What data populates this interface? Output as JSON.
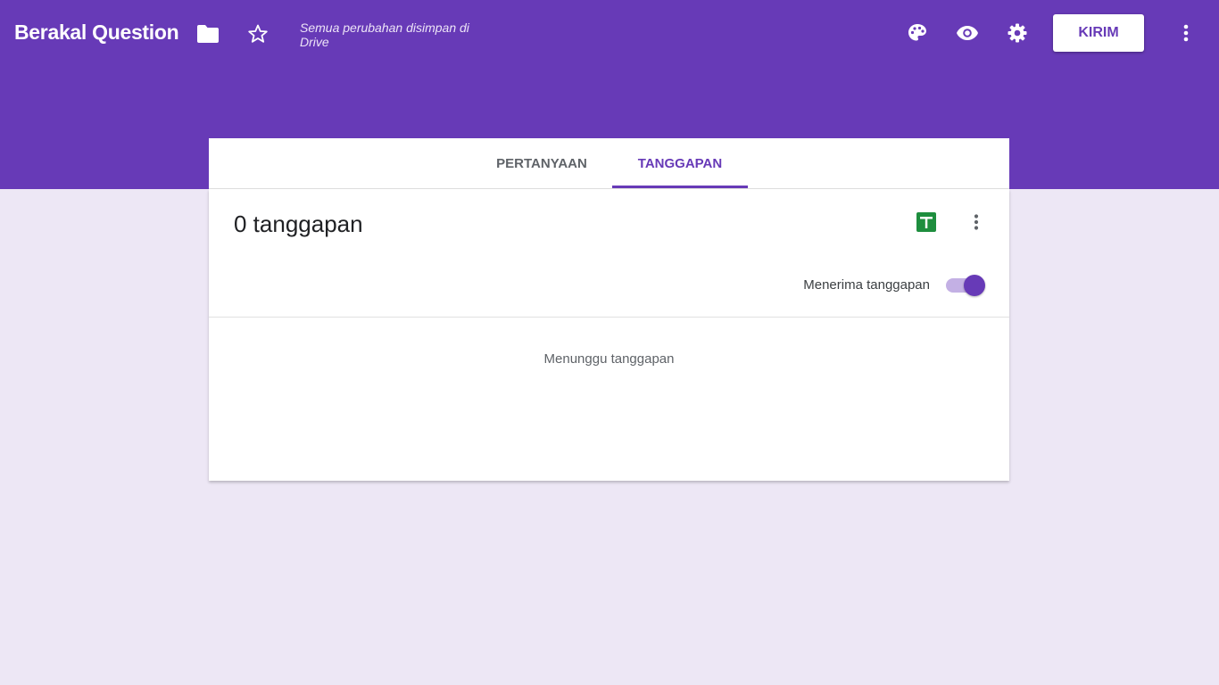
{
  "app": {
    "title": "Berakal Question",
    "save_status": "Semua perubahan disimpan di Drive",
    "send_label": "KIRIM"
  },
  "tabs": [
    {
      "label": "PERTANYAAN",
      "active": false
    },
    {
      "label": "TANGGAPAN",
      "active": true
    }
  ],
  "responses": {
    "count_label": "0 tanggapan",
    "accepting_label": "Menerima tanggapan",
    "accepting": true,
    "empty_message": "Menunggu tanggapan"
  },
  "icons": {
    "folder": "folder-icon",
    "star": "star-icon",
    "palette": "palette-icon",
    "preview": "eye-icon",
    "settings": "gear-icon",
    "more": "more-vert-icon",
    "sheets": "sheets-icon"
  },
  "colors": {
    "primary": "#673ab7",
    "background": "#ede7f5",
    "sheets_green": "#1e8e3e",
    "toggle_track": "#c3b0e4"
  }
}
